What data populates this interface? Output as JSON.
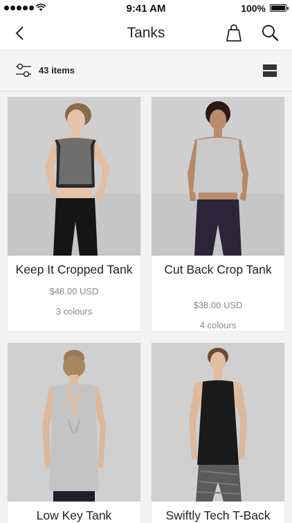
{
  "status_bar": {
    "time": "9:41 AM",
    "battery": "100%"
  },
  "nav": {
    "title": "Tanks"
  },
  "toolbar": {
    "items_count": "43 items"
  },
  "products": [
    {
      "name": "Keep It Cropped Tank",
      "price": "$48.00 USD",
      "colours": "3 colours"
    },
    {
      "name": "Cut Back Crop Tank",
      "price": "$38.00 USD",
      "colours": "4 colours"
    },
    {
      "name": "Low Key Tank",
      "price": "",
      "colours": ""
    },
    {
      "name": "Swiftly Tech T-Back",
      "price": "",
      "colours": ""
    }
  ],
  "icons": {
    "back": "chevron-left-icon",
    "bag": "shopping-bag-icon",
    "search": "search-icon",
    "filter": "filter-icon",
    "view": "grid-view-icon"
  }
}
